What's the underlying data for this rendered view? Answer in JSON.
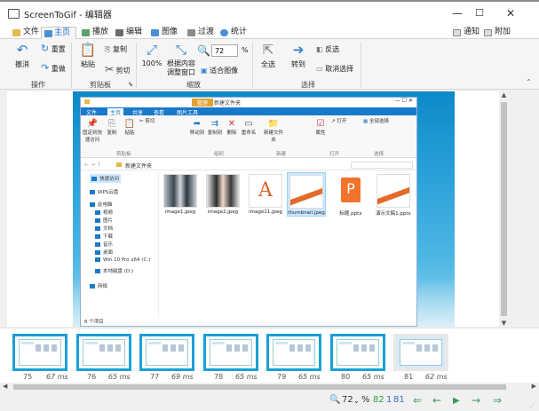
{
  "window": {
    "title": "ScreenToGif - 编辑器"
  },
  "menubar": {
    "tabs": [
      {
        "label": "文件",
        "color": "#e6b84a"
      },
      {
        "label": "主页",
        "color": "#4a8fd6"
      },
      {
        "label": "播放",
        "color": "#59a06a"
      },
      {
        "label": "编辑",
        "color": "#6a6a6a"
      },
      {
        "label": "图像",
        "color": "#4a8fd6"
      },
      {
        "label": "过渡",
        "color": "#8a8a8a"
      },
      {
        "label": "统计",
        "color": "#4a8fd6"
      }
    ],
    "notify_label": "通知",
    "attach_label": "附加"
  },
  "ribbon": {
    "undo": "撤消",
    "redo": "重置",
    "reset": "重做",
    "paste": "粘贴",
    "copy": "复制",
    "cut": "剪切",
    "zoom100": "100%",
    "fit_window": "根据内容调整窗口",
    "zoom_value": "72",
    "zoom_unit": "%",
    "fit_image": "适合图像",
    "select_all": "全选",
    "go_to": "转到",
    "invert": "反选",
    "deselect": "取消选择",
    "groups": {
      "action": "操作",
      "clipboard": "剪贴板",
      "zoom": "缩放",
      "select": "选择"
    }
  },
  "explorer": {
    "tabs": [
      "文件",
      "主页",
      "共享",
      "查看",
      "图片工具"
    ],
    "manage": "管理",
    "title_suffix": "新建文件夹",
    "ribbon_items": [
      "固定到快速访问",
      "复制",
      "粘贴",
      "剪切",
      "移动到",
      "复制到",
      "删除",
      "重命名",
      "新建文件夹",
      "属性",
      "打开",
      "全部选择"
    ],
    "ribbon_groups": [
      "剪贴板",
      "组织",
      "新建",
      "打开",
      "选择"
    ],
    "address": "新建文件夹",
    "nav": [
      "快速访问",
      "WPS云盘",
      "此电脑",
      "视频",
      "图片",
      "文档",
      "下载",
      "音乐",
      "桌面",
      "Win 10 Pro x64 (C:)",
      "本地磁盘 (D:)",
      "网络"
    ],
    "files": [
      "image1.jpeg",
      "image2.jpeg",
      "image11.jpeg",
      "thumbnail.jpeg",
      "标题.pptx",
      "演示文稿1.pptx"
    ],
    "status": "6 个项目"
  },
  "frames": [
    {
      "num": "75",
      "ms": "67 ms"
    },
    {
      "num": "76",
      "ms": "65 ms"
    },
    {
      "num": "77",
      "ms": "69 ms"
    },
    {
      "num": "78",
      "ms": "65 ms"
    },
    {
      "num": "79",
      "ms": "65 ms"
    },
    {
      "num": "80",
      "ms": "65 ms"
    },
    {
      "num": "81",
      "ms": "62 ms"
    }
  ],
  "statusbar": {
    "zoom_value": "72",
    "zoom_unit": "%",
    "frame_count": "82",
    "selected": "1",
    "current": "81"
  }
}
